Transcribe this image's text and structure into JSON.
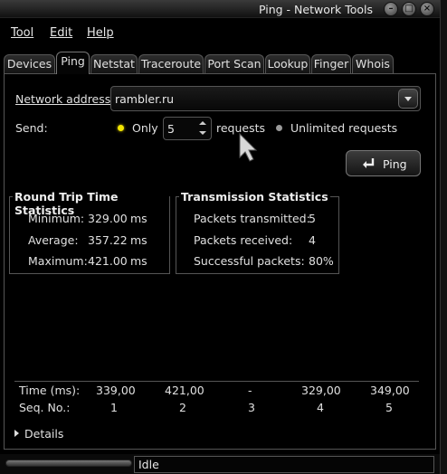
{
  "window": {
    "title": "Ping - Network Tools"
  },
  "titlebar_buttons": [
    "minimize-icon",
    "maximize-icon",
    "close-icon"
  ],
  "menu": [
    "Tool",
    "Edit",
    "Help"
  ],
  "tabs": [
    "Devices",
    "Ping",
    "Netstat",
    "Traceroute",
    "Port Scan",
    "Lookup",
    "Finger",
    "Whois"
  ],
  "active_tab": "Ping",
  "form": {
    "address_label": "Network address:",
    "address_value": "rambler.ru",
    "send_label": "Send:",
    "only_label": "Only",
    "count_value": "5",
    "requests_label": "requests",
    "unlimited_label": "Unlimited requests",
    "ping_button": "Ping"
  },
  "rtt": {
    "title": "Round Trip Time Statistics",
    "rows": [
      {
        "label": "Minimum:",
        "value": "329.00",
        "unit": "ms"
      },
      {
        "label": "Average:",
        "value": "357.22",
        "unit": "ms"
      },
      {
        "label": "Maximum:",
        "value": "421.00",
        "unit": "ms"
      }
    ]
  },
  "transmission": {
    "title": "Transmission Statistics",
    "rows": [
      {
        "label": "Packets transmitted:",
        "value": "5"
      },
      {
        "label": "Packets received:",
        "value": "4"
      },
      {
        "label": "Successful packets:",
        "value": "80%"
      }
    ]
  },
  "results": {
    "time_label": "Time (ms):",
    "seq_label": "Seq. No.:",
    "times": [
      "339,00",
      "421,00",
      "-",
      "329,00",
      "349,00"
    ],
    "seqs": [
      "1",
      "2",
      "3",
      "4",
      "5"
    ]
  },
  "details_label": "Details",
  "status": {
    "text": "Idle"
  },
  "colors": {
    "radio_selected": "#f2e500",
    "radio_unselected": "#9a9a9a",
    "background": "#000000"
  }
}
